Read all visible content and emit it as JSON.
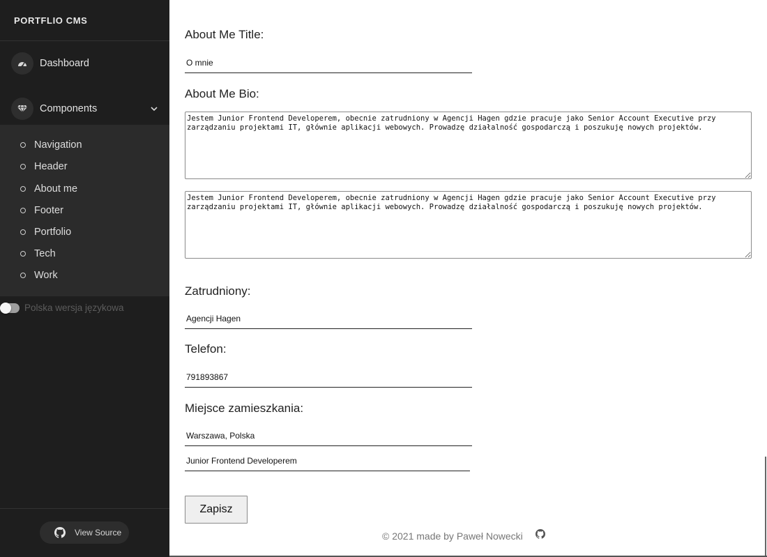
{
  "sidebar": {
    "brand": "PORTFLIO CMS",
    "nav": [
      {
        "label": "Dashboard",
        "icon": "speedometer-icon"
      },
      {
        "label": "Components",
        "icon": "diamond-icon",
        "expand_icon": "chevron-down-icon"
      }
    ],
    "submenu": [
      {
        "label": "Navigation"
      },
      {
        "label": "Header"
      },
      {
        "label": "About me"
      },
      {
        "label": "Footer"
      },
      {
        "label": "Portfolio"
      },
      {
        "label": "Tech"
      },
      {
        "label": "Work"
      }
    ],
    "language_toggle": {
      "label": "Polska wersja językowa",
      "on": false
    },
    "view_source_label": "View Source"
  },
  "form": {
    "title_heading": "About Me Title:",
    "title_value": "O mnie",
    "bio_heading": "About Me Bio:",
    "bio_value_1": "Jestem Junior Frontend Developerem, obecnie zatrudniony w Agencji Hagen gdzie pracuje jako Senior Account Executive przy zarządzaniu projektami IT, głównie aplikacji webowych. Prowadzę działalność gospodarczą i poszukuję nowych projektów.",
    "bio_value_2": "Jestem Junior Frontend Developerem, obecnie zatrudniony w Agencji Hagen gdzie pracuje jako Senior Account Executive przy zarządzaniu projektami IT, głównie aplikacji webowych. Prowadzę działalność gospodarczą i poszukuję nowych projektów.",
    "employed_heading": "Zatrudniony:",
    "employed_value": "Agencji Hagen",
    "phone_heading": "Telefon:",
    "phone_value": "791893867",
    "residence_heading": "Miejsce zamieszkania:",
    "residence_value": "Warszawa, Polska",
    "position_value": "Junior Frontend Developerem",
    "save_label": "Zapisz"
  },
  "footer": {
    "credit": "© 2021 made by Paweł Nowecki",
    "icon": "github-icon"
  },
  "colors": {
    "sidebar_bg": "#1e1e1e",
    "submenu_bg": "#2b2b2b",
    "text_light": "#e0e0e0",
    "main_bg": "#ffffff"
  }
}
